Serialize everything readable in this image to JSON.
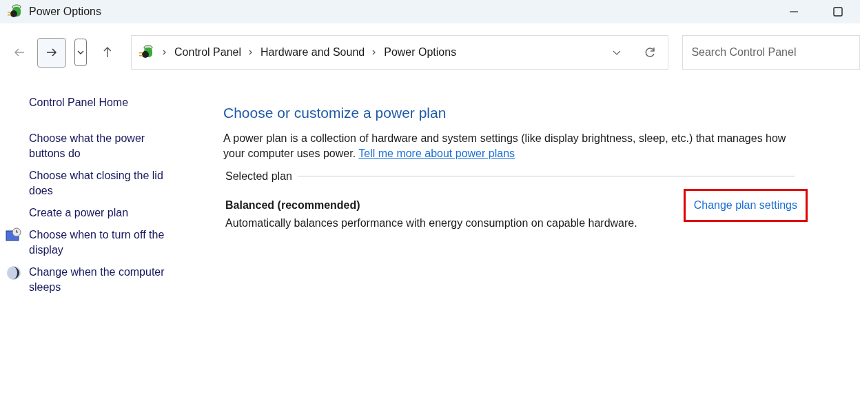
{
  "window": {
    "title": "Power Options"
  },
  "breadcrumb": [
    "Control Panel",
    "Hardware and Sound",
    "Power Options"
  ],
  "search": {
    "placeholder": "Search Control Panel"
  },
  "sidebar": {
    "items": [
      {
        "label": "Control Panel Home",
        "kind": "plain"
      },
      {
        "label": "Choose what the power buttons do",
        "kind": "plain"
      },
      {
        "label": "Choose what closing the lid does",
        "kind": "plain"
      },
      {
        "label": "Create a power plan",
        "kind": "plain"
      },
      {
        "label": "Choose when to turn off the display",
        "kind": "display"
      },
      {
        "label": "Change when the computer sleeps",
        "kind": "sleep"
      }
    ]
  },
  "main": {
    "heading": "Choose or customize a power plan",
    "description": "A power plan is a collection of hardware and system settings (like display brightness, sleep, etc.) that manages how your computer uses power.",
    "link": "Tell me more about power plans",
    "section": "Selected plan",
    "plan": {
      "name": "Balanced (recommended)",
      "description": "Automatically balances performance with energy consumption on capable hardware.",
      "action": "Change plan settings",
      "highlighted": true
    }
  }
}
